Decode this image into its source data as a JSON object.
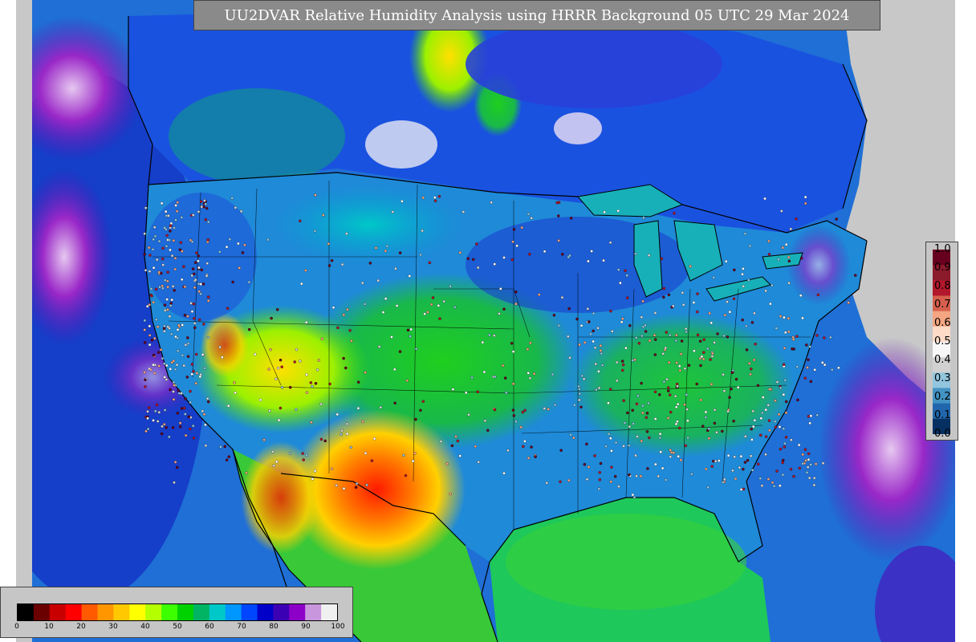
{
  "title": "UU2DVAR Relative Humidity Analysis using HRRR Background 05 UTC 29 Mar 2024",
  "observation_scale": {
    "ticks": [
      "1.0",
      "0.9",
      "0.8",
      "0.7",
      "0.6",
      "0.5",
      "0.4",
      "0.3",
      "0.2",
      "0.1",
      "0.0"
    ],
    "colors": [
      "#67001f",
      "#8b1a2b",
      "#b2182b",
      "#d6604d",
      "#f4a582",
      "#fddbc7",
      "#f7f7f7",
      "#d1d1d1",
      "#92c5de",
      "#4393c3",
      "#2166ac",
      "#053061"
    ]
  },
  "humidity_colorbar": {
    "ticks": [
      "0",
      "10",
      "20",
      "30",
      "40",
      "50",
      "60",
      "70",
      "80",
      "90",
      "100"
    ],
    "colors": [
      "#000000",
      "#6b0000",
      "#c80000",
      "#ff0000",
      "#ff5a00",
      "#ff9600",
      "#ffc800",
      "#ffff00",
      "#b4ff00",
      "#3cff00",
      "#00d200",
      "#00b464",
      "#00c8c8",
      "#0096ff",
      "#0046ff",
      "#0000c8",
      "#3c00b4",
      "#8c00c8",
      "#c896dc",
      "#f0f0f0"
    ]
  },
  "colors": {
    "land_outside": "#c8c8c8",
    "ocean_default": "#1f6fd6"
  }
}
